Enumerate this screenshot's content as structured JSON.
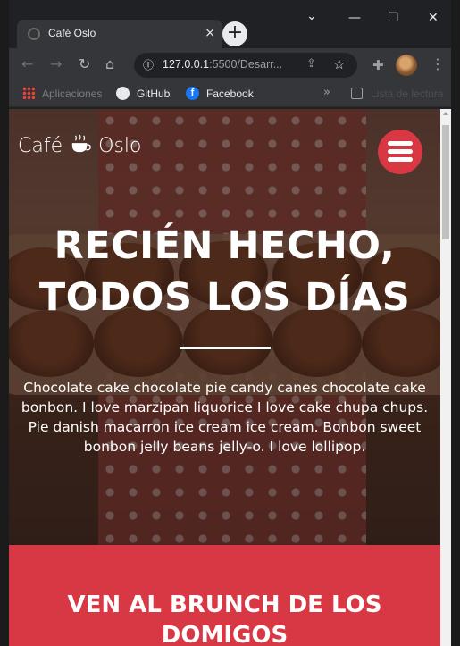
{
  "browser": {
    "tab_title": "Café Oslo",
    "tab_close": "×",
    "new_tab": "+",
    "window_controls": {
      "minimize": "—",
      "maximize": "☐",
      "close": "✕",
      "dropdown": "⌄"
    },
    "address": {
      "host": "127.0.0.1",
      "rest": ":5500/Desarr..."
    },
    "bookmarks": [
      {
        "label": "Aplicaciones",
        "icon": "apps-grid-icon"
      },
      {
        "label": "GitHub",
        "icon": "github-icon"
      },
      {
        "label": "Facebook",
        "icon": "facebook-icon"
      }
    ],
    "bookmarks_more": "»",
    "reading_list": "Lista de lectura"
  },
  "site": {
    "logo_text_left": "Café",
    "logo_text_right": "Oslo",
    "hero": {
      "title_line1": "RECIÉN HECHO,",
      "title_line2": "TODOS LOS DÍAS",
      "text": "Chocolate cake chocolate pie candy canes chocolate cake bonbon. I love marzipan liquorice I love cake chupa chups. Pie danish macarron ice cream ice cream. Bonbon sweet bonbon jelly beans jelly-o. I love lollipop."
    },
    "section2": {
      "title_line1": "VEN AL BRUNCH DE LOS",
      "title_line2": "DOMIGOS"
    }
  },
  "colors": {
    "accent": "#d73844",
    "browser_dark": "#202124",
    "browser_toolbar": "#35363a"
  }
}
